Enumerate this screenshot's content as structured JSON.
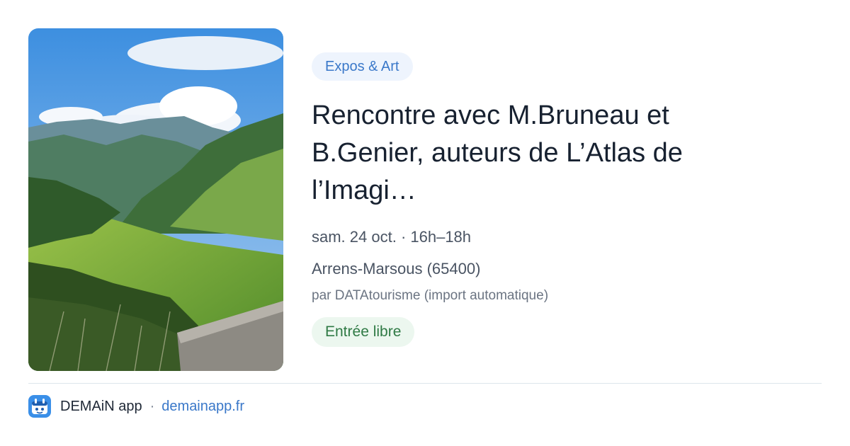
{
  "event": {
    "category": "Expos & Art",
    "title": "Rencontre avec M.Bruneau et B.Genier, auteurs de L’Atlas de l’Imagi…",
    "date": "sam. 24 oct. · 16h–18h",
    "place": "Arrens-Marsous (65400)",
    "source": "par DATAtourisme (import automatique)",
    "price": "Entrée libre",
    "image_icon": "mountain-valley-photo"
  },
  "footer": {
    "app_name": "DEMAiN app",
    "separator": "·",
    "link": "demainapp.fr",
    "logo_icon": "demain-app-logo-icon"
  },
  "colors": {
    "accent": "#3a78c9",
    "chip_bg": "#eef4fd",
    "price_green": "#2f7a45",
    "price_bg": "#ecf7ef",
    "divider": "#dde5ec"
  }
}
